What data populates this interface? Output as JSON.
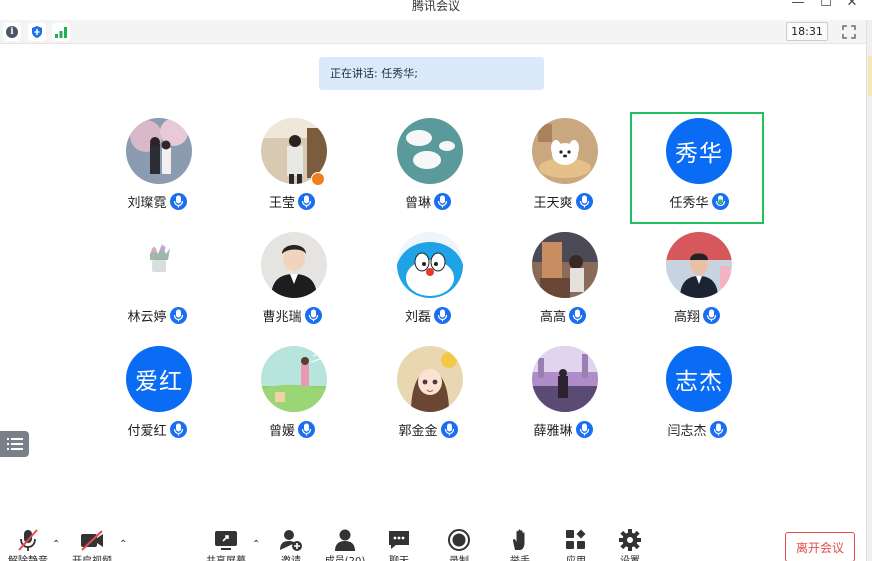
{
  "window": {
    "title": "腾讯会议",
    "min_glyph": "—",
    "max_glyph": "☐",
    "close_glyph": "✕"
  },
  "statusbar": {
    "time": "18:31",
    "icons": [
      "info-icon",
      "shield-icon",
      "signal-icon",
      "fullscreen-icon"
    ]
  },
  "speaking_banner": "正在讲话: 任秀华;",
  "participants": [
    {
      "name": "刘璨霓",
      "avatar": "photo"
    },
    {
      "name": "王莹",
      "avatar": "photo",
      "badge": "host"
    },
    {
      "name": "曾琳",
      "avatar": "photo"
    },
    {
      "name": "王天爽",
      "avatar": "photo"
    },
    {
      "name": "任秀华",
      "avatar_text": "秀华",
      "speaking": true
    },
    {
      "name": "林云婷",
      "avatar": "photo"
    },
    {
      "name": "曹兆瑞",
      "avatar": "photo"
    },
    {
      "name": "刘磊",
      "avatar": "photo"
    },
    {
      "name": "高高",
      "avatar": "photo"
    },
    {
      "name": "高翔",
      "avatar": "photo"
    },
    {
      "name": "付爱红",
      "avatar_text": "爱红"
    },
    {
      "name": "曾媛",
      "avatar": "photo"
    },
    {
      "name": "郭金金",
      "avatar": "photo"
    },
    {
      "name": "薛雅琳",
      "avatar": "photo"
    },
    {
      "name": "闫志杰",
      "avatar_text": "志杰"
    }
  ],
  "toolbar": {
    "unmute": "解除静音",
    "start_video": "开启视频",
    "share_screen": "共享屏幕",
    "invite": "邀请",
    "members": "成员(20)",
    "chat": "聊天",
    "record": "录制",
    "raise_hand": "举手",
    "apps": "应用",
    "settings": "设置",
    "leave": "离开会议"
  },
  "colors": {
    "accent": "#0a6cf4",
    "speaking_border": "#1fc15f",
    "leave": "#e34d4d",
    "banner_bg": "#dce9fb"
  }
}
